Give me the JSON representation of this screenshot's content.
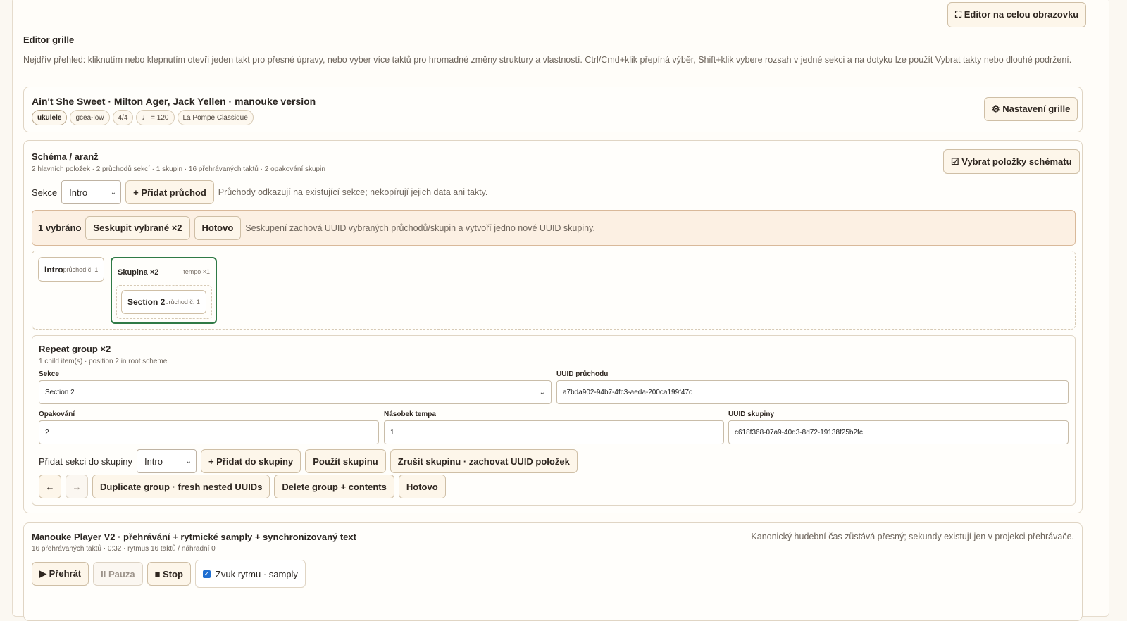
{
  "fullscreen_button": "⛶ Editor na celou obrazovku",
  "editor": {
    "title": "Editor grille",
    "description": "Nejdřív přehled: kliknutím nebo klepnutím otevři jeden takt pro přesné úpravy, nebo vyber více taktů pro hromadné změny struktury a vlastností. Ctrl/Cmd+klik přepíná výběr, Shift+klik vybere rozsah v jedné sekci a na dotyku lze použít Vybrat takty nebo dlouhé podržení."
  },
  "song": {
    "title": "Ain't She Sweet · Milton Ager, Jack Yellen · manouke version",
    "tags": [
      "ukulele",
      "gcea-low",
      "4/4",
      "♩ = 120",
      "La Pompe Classique"
    ],
    "settings_button": "⚙ Nastavení grille"
  },
  "scheme": {
    "title": "Schéma / aranž",
    "stats": "2 hlavních položek · 2 průchodů sekcí · 1 skupin · 16 přehrávaných taktů · 2 opakování skupin",
    "select_items_button": "☑ Vybrat položky schématu",
    "section_label": "Sekce",
    "section_value": "Intro",
    "add_pass_button": "+ Přidat průchod",
    "add_pass_hint": "Průchody odkazují na existující sekce; nekopírují jejich data ani takty.",
    "selection": {
      "count": "1 vybráno",
      "group_button": "Seskupit vybrané ×2",
      "done_button": "Hotovo",
      "hint": "Seskupení zachová UUID vybraných průchodů/skupin a vytvoří jedno nové UUID skupiny."
    },
    "items": {
      "intro": {
        "name": "Intro",
        "sub": "průchod č. 1"
      },
      "group": {
        "name": "Skupina ×2",
        "tempo": "tempo ×1"
      },
      "section2": {
        "name": "Section 2",
        "sub": "průchod č. 1"
      }
    }
  },
  "repeat_group": {
    "title": "Repeat group ×2",
    "subtitle": "1 child item(s) · position 2 in root scheme",
    "section_label": "Sekce",
    "section_value": "Section 2",
    "pass_uuid_label": "UUID průchodu",
    "pass_uuid_value": "a7bda902-94b7-4fc3-aeda-200ca199f47c",
    "repeat_label": "Opakování",
    "repeat_value": "2",
    "tempo_label": "Násobek tempa",
    "tempo_value": "1",
    "group_uuid_label": "UUID skupiny",
    "group_uuid_value": "c618f368-07a9-40d3-8d72-19138f25b2fc",
    "add_section_label": "Přidat sekci do skupiny",
    "add_section_value": "Intro",
    "add_to_group_button": "+ Přidat do skupiny",
    "use_group_button": "Použít skupinu",
    "ungroup_button": "Zrušit skupinu · zachovat UUID položek",
    "left_button": "←",
    "right_button": "→",
    "duplicate_button": "Duplicate group · fresh nested UUIDs",
    "delete_button": "Delete group + contents",
    "done_button": "Hotovo"
  },
  "player": {
    "title": "Manouke Player V2 · přehrávání + rytmické samply + synchronizovaný text",
    "stats": "16 přehrávaných taktů · 0:32 · rytmus 16 taktů / náhradní 0",
    "note": "Kanonický hudební čas zůstává přesný; sekundy existují jen v projekci přehrávače.",
    "play_button": "▶ Přehrát",
    "pause_button": "II Pauza",
    "stop_button": "■ Stop",
    "rhythm_label": "Zvuk rytmu · samply"
  }
}
